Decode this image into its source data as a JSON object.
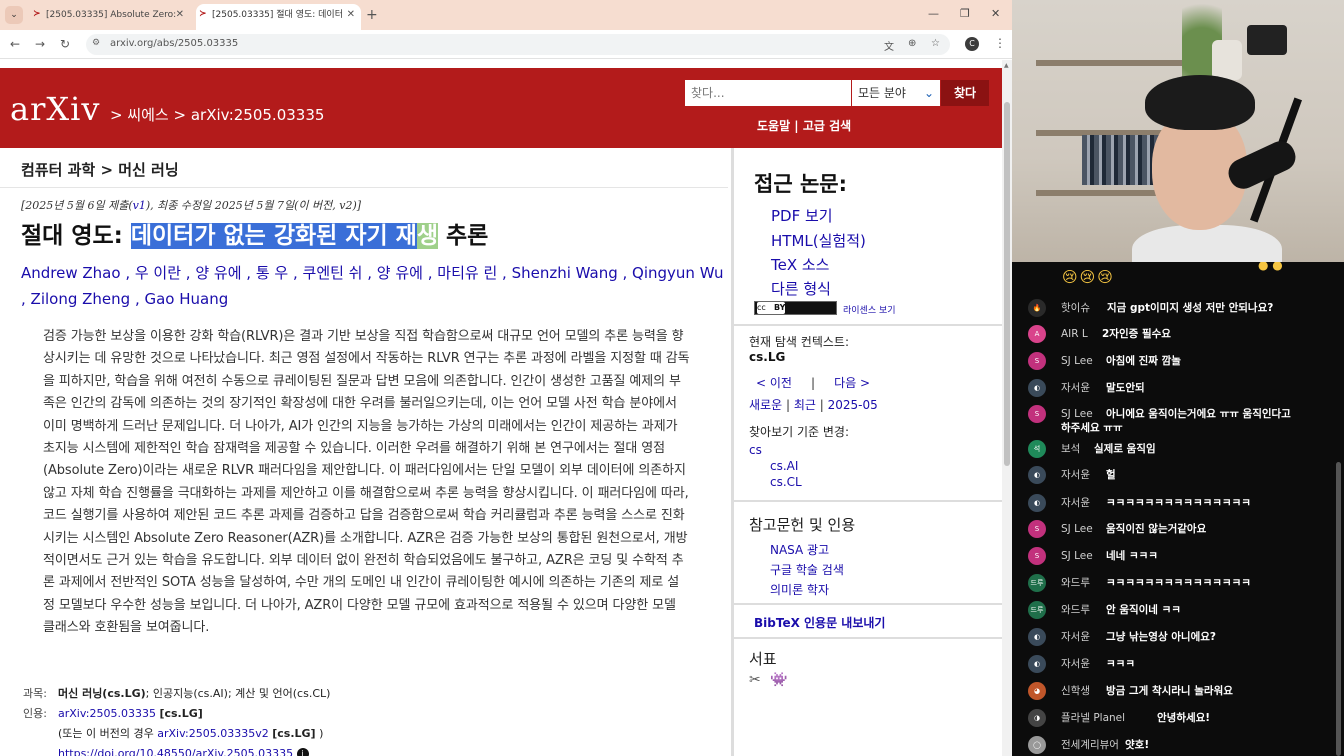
{
  "browser": {
    "tabs": [
      {
        "label": "[2505.03335] Absolute Zero: R"
      },
      {
        "label": "[2505.03335] 절대 영도: 데이터"
      }
    ],
    "url": "arxiv.org/abs/2505.03335",
    "profile_initial": "C"
  },
  "header": {
    "logo": "arXiv",
    "breadcrumb": "> 씨에스 > arXiv:2505.03335",
    "search_placeholder": "찾다...",
    "field_select": "모든 분야",
    "search_button": "찾다",
    "help_links": "도움말 | 고급 검색"
  },
  "subject": "컴퓨터 과학 > 머신 러닝",
  "dateline": {
    "prefix": "[2025년 5월 6일 제출(",
    "v1": "v1",
    "suffix": "), 최종 수정일 2025년 5월 7일(이 버전, v2)]"
  },
  "title": {
    "prefix": "절대 영도: ",
    "highlighted": "데이터가 없는 강화된 자기 재",
    "highlighted2": "생",
    "suffix": " 추론"
  },
  "authors": [
    "Andrew Zhao",
    "우 이란",
    "양 유에",
    "통 우",
    "쿠엔틴 쉬",
    "양 유에",
    "마티유 린",
    "Shenzhi Wang",
    "Qingyun Wu",
    "Zilong Zheng",
    "Gao Huang"
  ],
  "abstract": "검증 가능한 보상을 이용한 강화 학습(RLVR)은 결과 기반 보상을 직접 학습함으로써 대규모 언어 모델의 추론 능력을 향상시키는 데 유망한 것으로 나타났습니다. 최근 영점 설정에서 작동하는 RLVR 연구는 추론 과정에 라벨을 지정할 때 감독을 피하지만, 학습을 위해 여전히 수동으로 큐레이팅된 질문과 답변 모음에 의존합니다. 인간이 생성한 고품질 예제의 부족은 인간의 감독에 의존하는 것의 장기적인 확장성에 대한 우려를 불러일으키는데, 이는 언어 모델 사전 학습 분야에서 이미 명백하게 드러난 문제입니다. 더 나아가, AI가 인간의 지능을 능가하는 가상의 미래에서는 인간이 제공하는 과제가 초지능 시스템에 제한적인 학습 잠재력을 제공할 수 있습니다. 이러한 우려를 해결하기 위해 본 연구에서는 절대 영점(Absolute Zero)이라는 새로운 RLVR 패러다임을 제안합니다. 이 패러다임에서는 단일 모델이 외부 데이터에 의존하지 않고 자체 학습 진행률을 극대화하는 과제를 제안하고 이를 해결함으로써 추론 능력을 향상시킵니다. 이 패러다임에 따라, 코드 실행기를 사용하여 제안된 코드 추론 과제를 검증하고 답을 검증함으로써 학습 커리큘럼과 추론 능력을 스스로 진화시키는 시스템인 Absolute Zero Reasoner(AZR)를 소개합니다. AZR은 검증 가능한 보상의 통합된 원천으로서, 개방적이면서도 근거 있는 학습을 유도합니다. 외부 데이터 없이 완전히 학습되었음에도 불구하고, AZR은 코딩 및 수학적 추론 과제에서 전반적인 SOTA 성능을 달성하여, 수만 개의 도메인 내 인간이 큐레이팅한 예시에 의존하는 기존의 제로 설정 모델보다 우수한 성능을 보입니다. 더 나아가, AZR이 다양한 모델 규모에 효과적으로 적용될 수 있으며 다양한 모델 클래스와 호환됨을 보여줍니다.",
  "meta": {
    "subjects_label": "과목:",
    "subjects_main": "머신 러닝(cs.LG)",
    "subjects_rest": "; 인공지능(cs.AI); 계산 및 언어(cs.CL)",
    "cite_label": "인용:",
    "cite_id": "arXiv:2505.03335",
    "cite_tag": "[cs.LG]",
    "version_prefix": "(또는 이 버전의 경우 ",
    "version_id": "arXiv:2505.03335v2",
    "version_tag": "[cs.LG]",
    "version_suffix": ")",
    "doi": "https://doi.org/10.48550/arXiv.2505.03335"
  },
  "sidebar": {
    "access_title": "접근 논문:",
    "access_links": [
      "PDF 보기",
      "HTML(실험적)",
      "TeX 소스",
      "다른 형식"
    ],
    "license_link": "라이센스 보기",
    "cc_label": "cc",
    "by_label": "BY",
    "context_label": "현재 탐색 컨텍스트:",
    "context_value": "cs.LG",
    "prev": "< 이전",
    "next": "다음 >",
    "new": "새로운",
    "recent": "최근",
    "month": "2025-05",
    "browse_label": "찾아보기 기준 변경:",
    "browse_items": [
      "cs",
      "cs.AI",
      "cs.CL"
    ],
    "refs_title": "참고문헌 및 인용",
    "ref_links": [
      "NASA 광고",
      "구글 학술 검색",
      "의미론 학자"
    ],
    "bibtex": "BibTeX 인용문 내보내기",
    "bookmark_title": "서표"
  },
  "chat": {
    "messages": [
      {
        "name": "핫이슈",
        "text": "지금 gpt이미지 생성 저만 안되나요?",
        "color": "#2a2a2a",
        "icon": "🔥"
      },
      {
        "name": "AIR L",
        "text": "2자인증 필수요",
        "color": "#d9438b",
        "icon": "A"
      },
      {
        "name": "SJ Lee",
        "text": "아침에 진짜 깜놀",
        "color": "#c2317d",
        "icon": "S"
      },
      {
        "name": "자서윤",
        "text": "말도안되",
        "color": "#3a4a5a",
        "icon": "◐"
      },
      {
        "name": "SJ Lee",
        "text": "아니에요 움직이는거에요 ㅠㅠ 움직인다고",
        "text2": "하주세요 ㅠㅠ",
        "color": "#c2317d",
        "icon": "S"
      },
      {
        "name": "보석",
        "text": "실제로 움직임",
        "color": "#1f8a5a",
        "icon": "석"
      },
      {
        "name": "자서윤",
        "text": "헐",
        "color": "#3a4a5a",
        "icon": "◐"
      },
      {
        "name": "자서윤",
        "text": "ㅋㅋㅋㅋㅋㅋㅋㅋㅋㅋㅋㅋㅋㅋㅋ",
        "color": "#3a4a5a",
        "icon": "◐"
      },
      {
        "name": "SJ Lee",
        "text": "움직이진 않는거같아요",
        "color": "#c2317d",
        "icon": "S"
      },
      {
        "name": "SJ Lee",
        "text": "네네 ㅋㅋㅋ",
        "color": "#c2317d",
        "icon": "S"
      },
      {
        "name": "와드루",
        "text": "ㅋㅋㅋㅋㅋㅋㅋㅋㅋㅋㅋㅋㅋㅋㅋ",
        "color": "#1f6f4a",
        "icon": "드루"
      },
      {
        "name": "와드루",
        "text": "안 움직이네 ㅋㅋ",
        "color": "#1f6f4a",
        "icon": "드루"
      },
      {
        "name": "자서윤",
        "text": "그냥 낚는영상 아니에요?",
        "color": "#3a4a5a",
        "icon": "◐"
      },
      {
        "name": "자서윤",
        "text": "ㅋㅋㅋ",
        "color": "#3a4a5a",
        "icon": "◐"
      },
      {
        "name": "신학생",
        "text": "방금 그게 착시라니 놀라워요",
        "color": "#c0562a",
        "icon": "◕"
      },
      {
        "name": "플라넬 Planel",
        "text": "안녕하세요!",
        "color": "#444",
        "icon": "◑"
      },
      {
        "name": "전세계리뷰어",
        "text": "얏호!",
        "color": "#999",
        "icon": "◯"
      }
    ]
  }
}
